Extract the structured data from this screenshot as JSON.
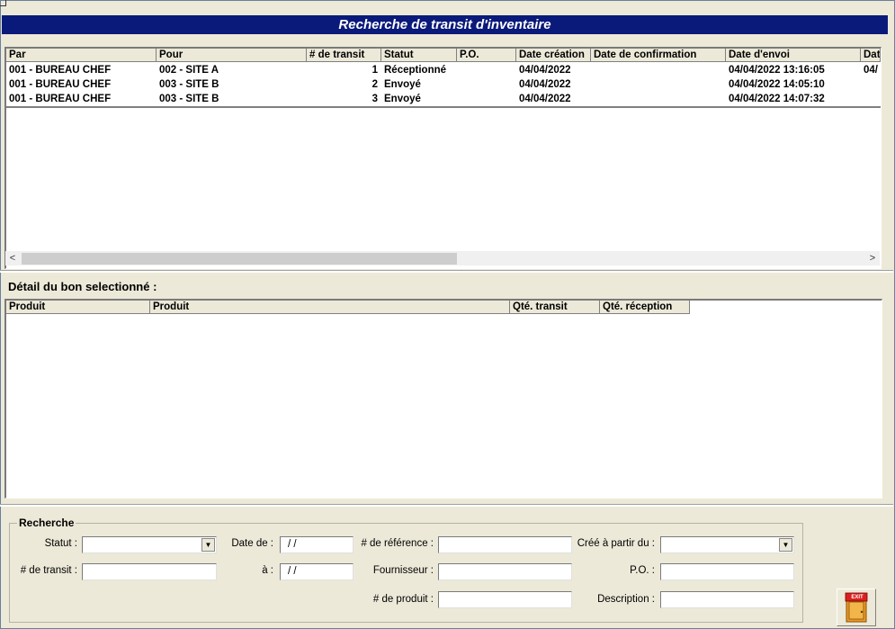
{
  "window": {
    "title": "Recherche de transit d'inventaire"
  },
  "grid": {
    "columns": [
      "Par",
      "Pour",
      "# de transit",
      "Statut",
      "P.O.",
      "Date création",
      "Date de confirmation",
      "Date d'envoi",
      "Dat"
    ],
    "rows": [
      [
        "001 - BUREAU CHEF",
        "002 - SITE A",
        "1",
        "Réceptionné",
        "",
        "04/04/2022",
        "",
        "04/04/2022 13:16:05",
        "04/"
      ],
      [
        "001 - BUREAU CHEF",
        "003 - SITE B",
        "2",
        "Envoyé",
        "",
        "04/04/2022",
        "",
        "04/04/2022 14:05:10",
        ""
      ],
      [
        "001 - BUREAU CHEF",
        "003 - SITE B",
        "3",
        "Envoyé",
        "",
        "04/04/2022",
        "",
        "04/04/2022 14:07:32",
        ""
      ]
    ]
  },
  "scroll": {
    "left": "<",
    "right": ">"
  },
  "detail": {
    "label": "Détail du bon selectionné :",
    "columns": [
      "Produit",
      "Produit",
      "Qté. transit",
      "Qté. réception"
    ]
  },
  "search": {
    "legend": "Recherche",
    "statut_label": "Statut :",
    "statut_value": "",
    "transit_label": "# de transit :",
    "transit_value": "",
    "date_de_label": "Date de :",
    "date_de_value": "/ /",
    "a_label": "à :",
    "a_value": "/ /",
    "reference_label": "# de référence :",
    "reference_value": "",
    "fournisseur_label": "Fournisseur :",
    "fournisseur_value": "",
    "produit_label": "# de produit :",
    "produit_value": "",
    "cree_label": "Créé à partir du :",
    "cree_value": "",
    "po_label": "P.O. :",
    "po_value": "",
    "description_label": "Description :",
    "description_value": ""
  },
  "exit": {
    "label": "EXIT"
  },
  "colors": {
    "title_bg": "#0a1a7a",
    "window_bg": "#ece9d8",
    "exit_door": "#e89a2a"
  }
}
